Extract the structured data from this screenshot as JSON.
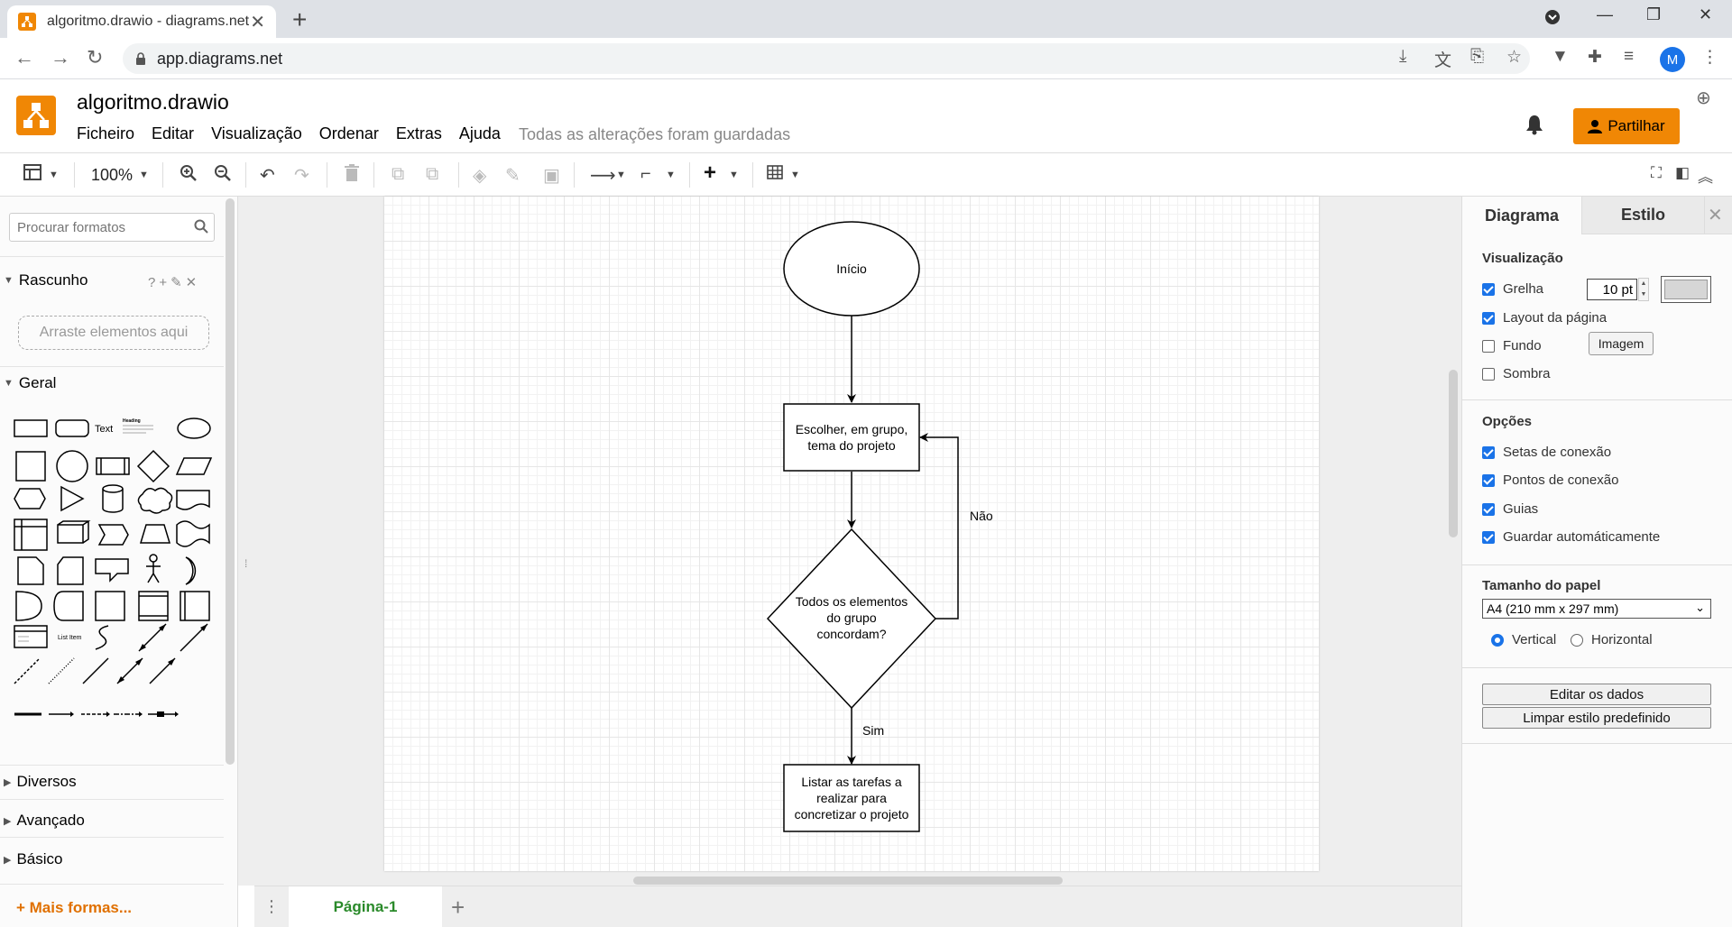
{
  "browser": {
    "tab_title": "algoritmo.drawio - diagrams.net",
    "url": "app.diagrams.net",
    "profile_initial": "M"
  },
  "app": {
    "doc_title": "algoritmo.drawio",
    "menus": [
      "Ficheiro",
      "Editar",
      "Visualização",
      "Ordenar",
      "Extras",
      "Ajuda"
    ],
    "save_status": "Todas as alterações foram guardadas",
    "share_label": "Partilhar"
  },
  "toolbar": {
    "zoom": "100%"
  },
  "left_panel": {
    "search_placeholder": "Procurar formatos",
    "scratch_title": "Rascunho",
    "scratch_tools": "?+✎✕",
    "drop_hint": "Arraste elementos aqui",
    "general_title": "Geral",
    "shape_text_label": "Text",
    "shape_heading_label": "Heading",
    "shape_listitem_label": "List Item",
    "collapsed_sections": [
      "Diversos",
      "Avançado",
      "Básico"
    ],
    "more_shapes": "+ Mais formas..."
  },
  "diagram": {
    "start": "Início",
    "step1_line1": "Escolher, em grupo,",
    "step1_line2": "tema do projeto",
    "decision_line1": "Todos os elementos",
    "decision_line2": "do grupo",
    "decision_line3": "concordam?",
    "no_label": "Não",
    "yes_label": "Sim",
    "step2_line1": "Listar as tarefas a",
    "step2_line2": "realizar para",
    "step2_line3": "concretizar o projeto"
  },
  "page_tabs": {
    "active": "Página-1"
  },
  "right_panel": {
    "tab_diagram": "Diagrama",
    "tab_style": "Estilo",
    "view_title": "Visualização",
    "grid_label": "Grelha",
    "grid_size": "10 pt",
    "page_layout_label": "Layout da página",
    "background_label": "Fundo",
    "image_button": "Imagem",
    "shadow_label": "Sombra",
    "options_title": "Opções",
    "connection_arrows": "Setas de conexão",
    "connection_points": "Pontos de conexão",
    "guides": "Guias",
    "autosave": "Guardar automáticamente",
    "paper_title": "Tamanho do papel",
    "paper_size": "A4 (210 mm x 297 mm)",
    "portrait": "Vertical",
    "landscape": "Horizontal",
    "edit_data": "Editar os dados",
    "clear_style": "Limpar estilo predefinido"
  },
  "colors": {
    "accent": "#f08705",
    "checkbox": "#1a73e8",
    "page_tab_text": "#2a8a2a"
  }
}
